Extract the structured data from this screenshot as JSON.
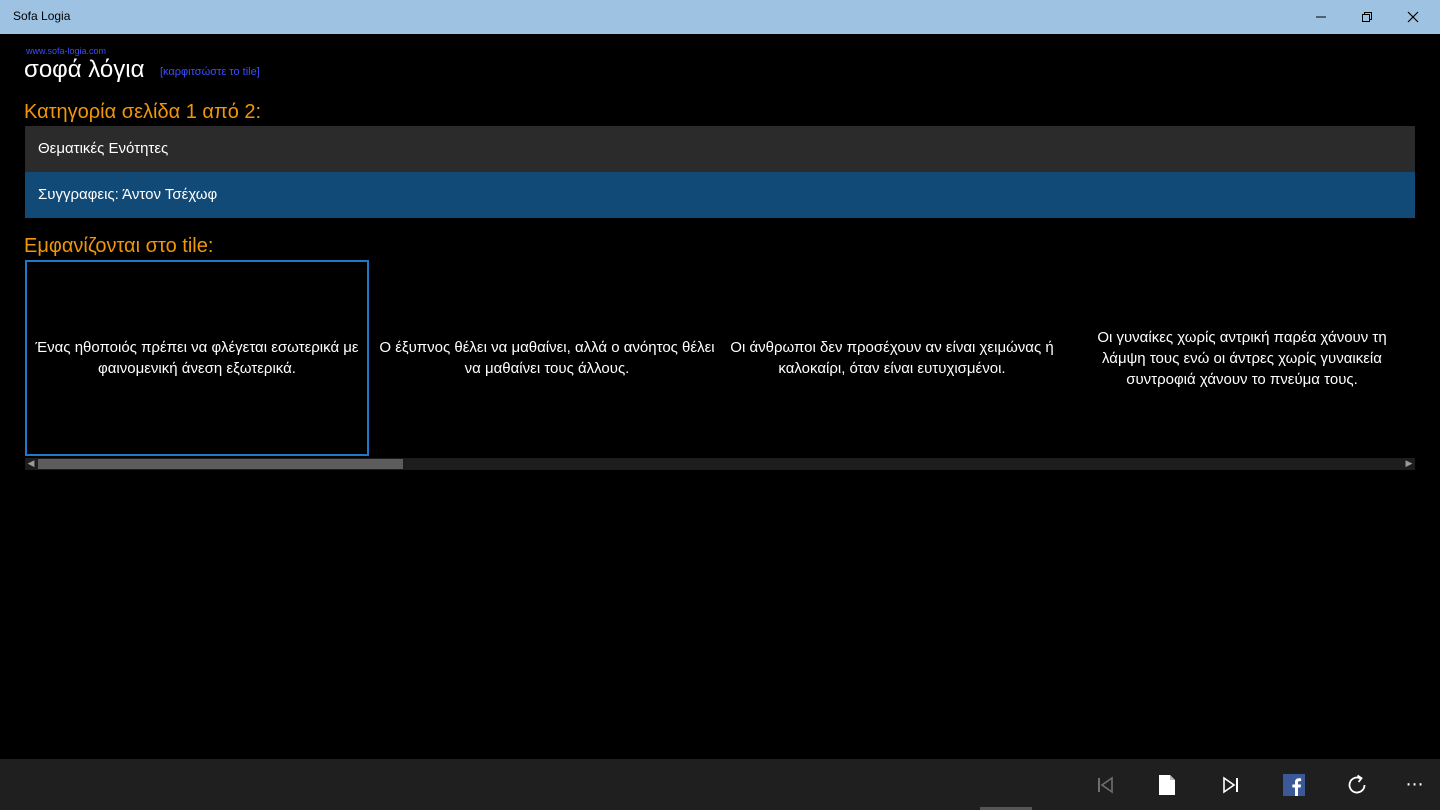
{
  "window": {
    "title": "Sofa Logia",
    "controls": [
      "minimize-icon",
      "restore-icon",
      "close-icon"
    ]
  },
  "header": {
    "url": "www.sofa-logia.com",
    "app_name": "σοφά λόγια",
    "pin_link": "[καρφιτσώστε το tile]"
  },
  "category": {
    "heading": "Κατηγορία σελίδα 1 από 2:",
    "items": [
      {
        "label": "Θεματικές Ενότητες",
        "selected": false
      },
      {
        "label": "Συγγραφεις: Άντον Τσέχωφ",
        "selected": true
      }
    ]
  },
  "tiles": {
    "heading": "Εμφανίζονται στο tile:",
    "quotes": [
      "Ένας ηθοποιός πρέπει να φλέγεται εσωτερικά με φαινομενική άνεση εξωτερικά.",
      "Ο έξυπνος θέλει να μαθαίνει, αλλά ο ανόητος θέλει να μαθαίνει τους άλλους.",
      "Οι άνθρωποι δεν προσέχουν αν είναι χειμώνας ή καλοκαίρι, όταν είναι ευτυχισμένοι.",
      "Οι γυναίκες χωρίς αντρική παρέα χάνουν τη λάμψη τους ενώ οι άντρες χωρίς γυναικεία συντροφιά χάνουν το πνεύμα τους."
    ]
  },
  "appbar": {
    "buttons": [
      "skip-first-icon",
      "page-icon",
      "skip-last-icon",
      "facebook-icon",
      "refresh-icon",
      "more-icon"
    ],
    "more_label": "⋯"
  },
  "colors": {
    "titlebar": "#9ec3e2",
    "accent_heading": "#f0960a",
    "link": "#3d4dff",
    "selected_item": "#114a77",
    "list_item": "#2b2b2b",
    "focus_border": "#1f78c8",
    "facebook": "#3b5998"
  }
}
